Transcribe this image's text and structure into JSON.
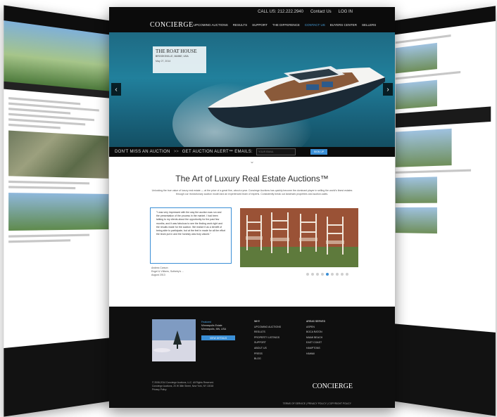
{
  "main": {
    "topbar": {
      "call": "CALL US: 212.222.2940",
      "contact": "Contact Us",
      "login": "LOG IN"
    },
    "navbar": {
      "logo": "CONCIERGE",
      "links": [
        "UPCOMING AUCTIONS",
        "RESULTS",
        "SUPPORT",
        "THE DIFFERENCE",
        "CONTACT US",
        "BUYERS CENTER",
        "SELLERS"
      ],
      "active_index": 4
    },
    "hero": {
      "caption_title": "THE ROAT HOUSE",
      "caption_subtitle": "BROOKSVILLE, MAINE, USA",
      "caption_date": "May 27, 2014"
    },
    "alertbar": {
      "dont_miss": "DON'T MISS AN AUCTION",
      "arrows": ">>",
      "get_alerts": "GET AUCTION ALERT™ EMAILS:",
      "email_placeholder": "YOUR EMAIL",
      "signup": "SIGN UP"
    },
    "headline": "The Art of Luxury Real Estate Auctions™",
    "intro": "Unlocking the true value of luxury real estate — at the price of a great fine, about a year. Concierge Auctions has quickly become the dominant player in selling the world's finest estates through our revolutionary auction model and an experienced team of experts. Consistently break out landmark properties and auction-sales.",
    "testimonial": {
      "quote": "\"I was very impressed with the way the auction was run and the presentation of the process in the market. I had been talking to my clients about the opportunity for the past few months, and it was fabulous to see the finding work right and the results made for the auction. We realize it as a benefit of being able to participate, but at the feel in made for all the effort the team put in and the honesty was truly valued.\"",
      "name": "Andrea Carson",
      "company": "Engel & Völkers, Sotheby's ...",
      "date": "August 2013"
    },
    "slider_dots": 9,
    "slider_active_dot": 4,
    "footer": {
      "feature_label": "Featured",
      "feature_name": "Minneapolis Estate",
      "feature_location": "Minneapolis, MN, USA",
      "view_button": "VIEW DETAILS",
      "col1_heading": "WHY",
      "col1_items": [
        "UPCOMING AUCTIONS",
        "RESULTS",
        "PROPERTY LISTINGS",
        "SUPPORT",
        "ABOUT US",
        "PRESS",
        "BLOG"
      ],
      "col2_heading": "AREAS SERVED",
      "col2_items": [
        "ASPEN",
        "BOCA RATON",
        "MIAMI BEACH",
        "EAST COAST",
        "HAMPTONS",
        "HAWAII"
      ],
      "copyright": "© 2008-2014 Concierge Auctions, LLC. All Rights Reserved.",
      "address": "Concierge Auctions, 20 W 36th Street, New York, NY 10018",
      "privacy": "Privacy Policy",
      "links": "TERMS OF SERVICE  |  PRIVACY POLICY  |  COPYRIGHT POLICY",
      "logo": "CONCIERGE"
    }
  },
  "colors": {
    "accent": "#3a8fd6",
    "dark": "#0b0b0b"
  }
}
